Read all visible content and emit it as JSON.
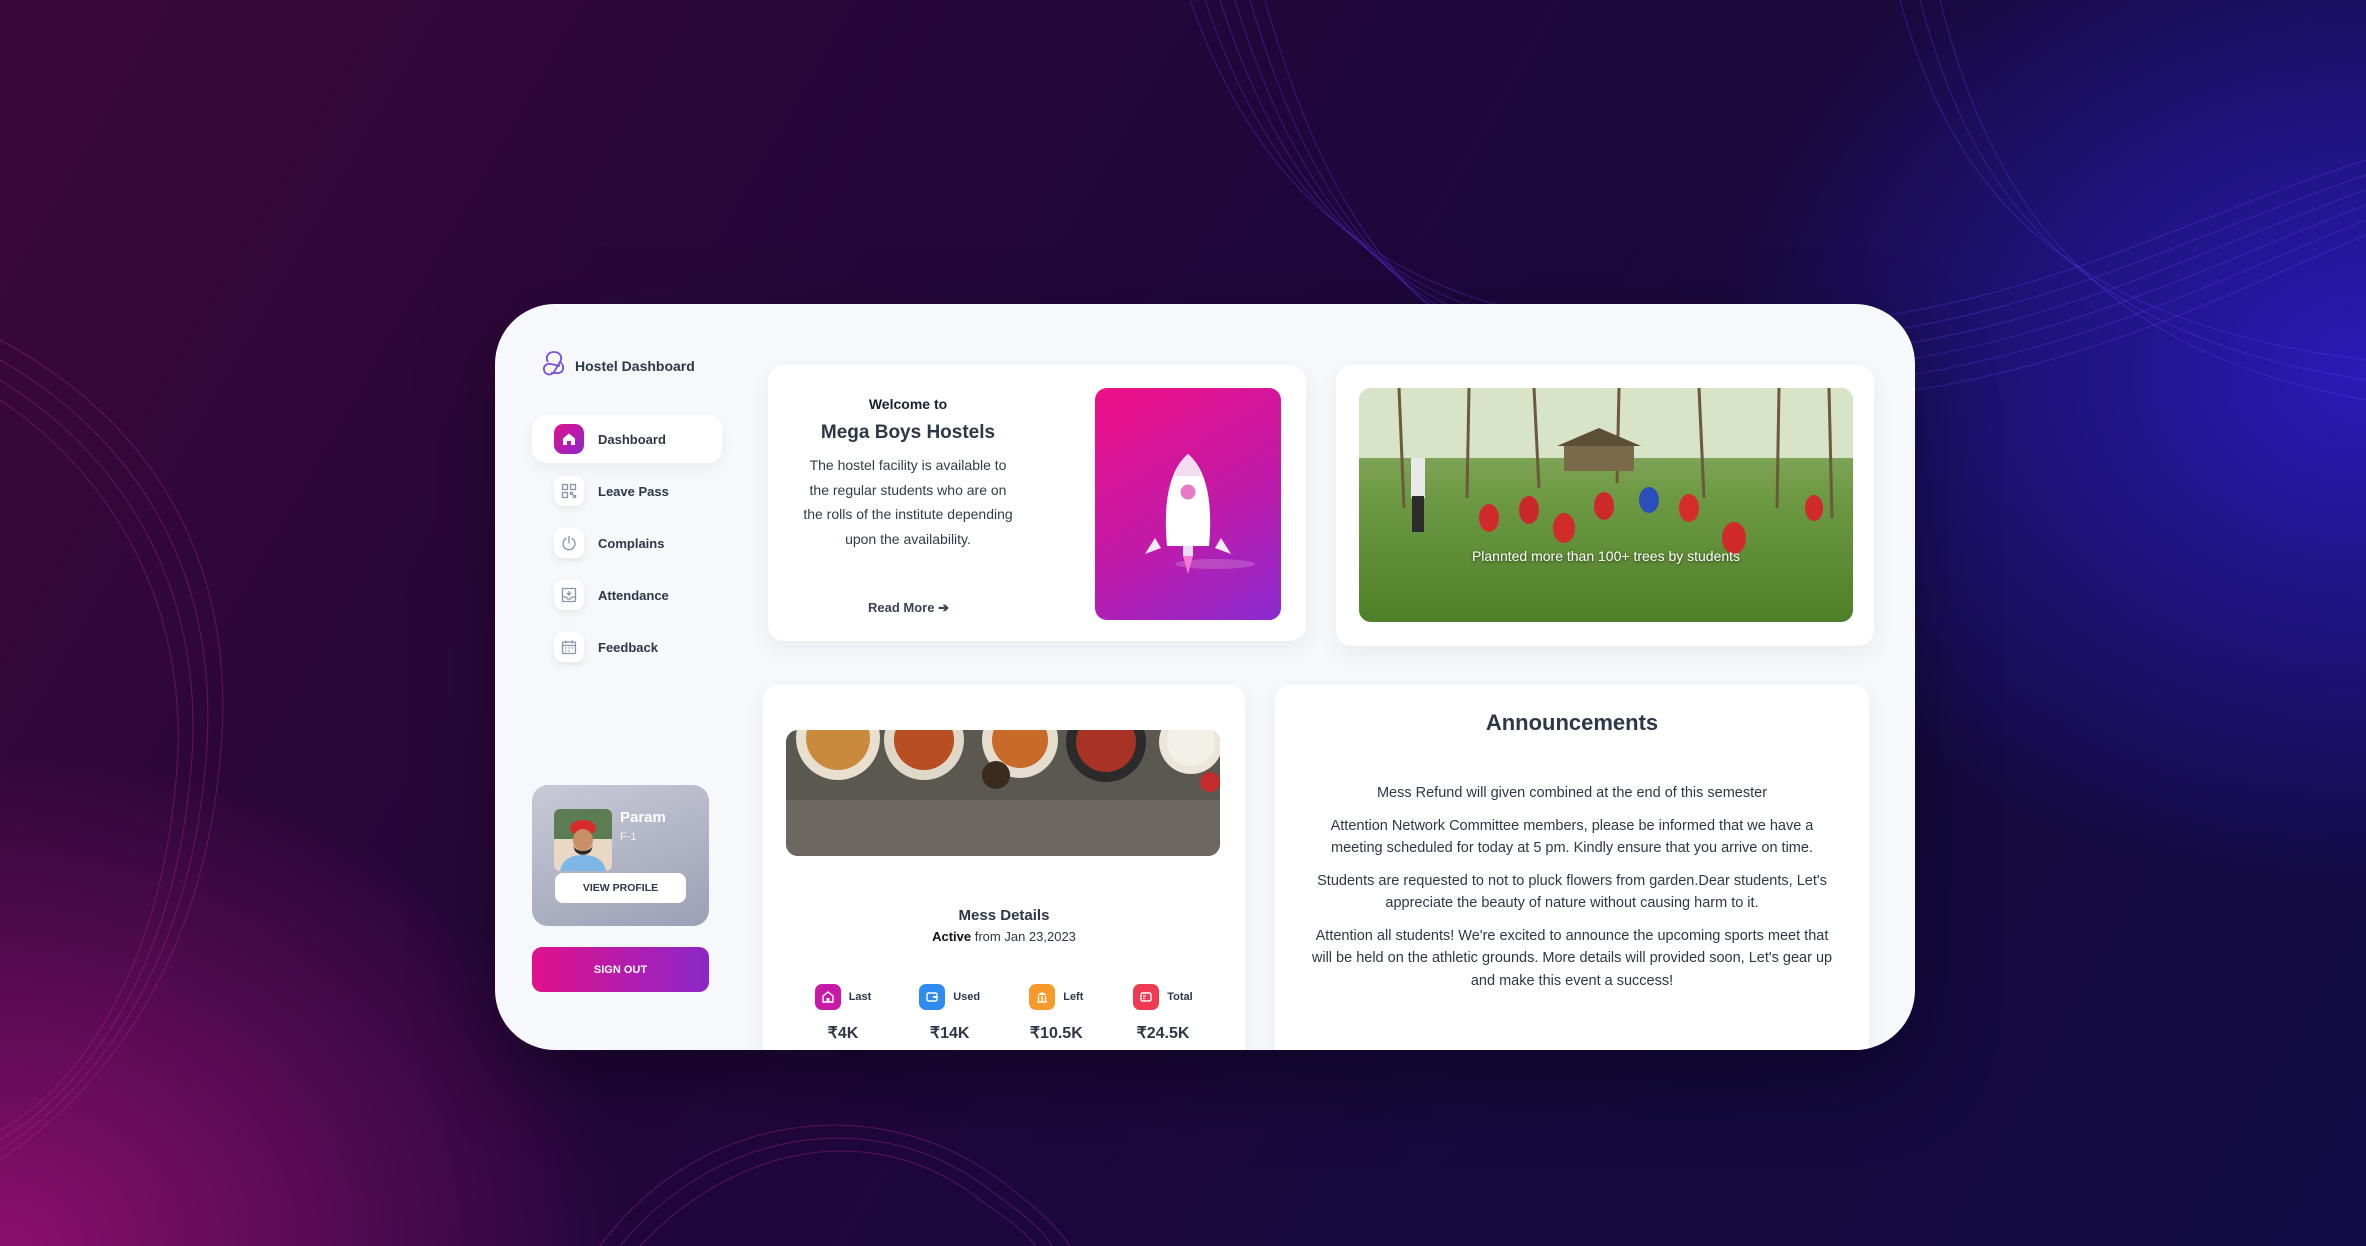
{
  "brand": {
    "name": "Hostel Dashboard"
  },
  "sidebar": {
    "items": [
      {
        "label": "Dashboard",
        "icon": "home-icon",
        "active": true
      },
      {
        "label": "Leave Pass",
        "icon": "qr-icon"
      },
      {
        "label": "Complains",
        "icon": "power-icon"
      },
      {
        "label": "Attendance",
        "icon": "inbox-icon"
      },
      {
        "label": "Feedback",
        "icon": "calendar-icon"
      }
    ]
  },
  "profile": {
    "name": "Param",
    "room": "F-1",
    "view_label": "VIEW PROFILE"
  },
  "signout_label": "SIGN OUT",
  "welcome": {
    "pre": "Welcome to",
    "title": "Mega Boys Hostels",
    "body": "The hostel facility is available to the regular students who are on the rolls of the institute depending upon the availability.",
    "read_more": "Read More"
  },
  "carousel": {
    "caption": "Plannted more than 100+ trees by students"
  },
  "mess": {
    "title": "Mess Details",
    "status": "Active",
    "since": "from Jan 23,2023",
    "stats": [
      {
        "label": "Last",
        "value": "₹4K",
        "color": "#c71aa7",
        "icon": "house-icon"
      },
      {
        "label": "Used",
        "value": "₹14K",
        "color": "#2f8bf0",
        "icon": "wallet-icon"
      },
      {
        "label": "Left",
        "value": "₹10.5K",
        "color": "#f59a2b",
        "icon": "bank-icon"
      },
      {
        "label": "Total",
        "value": "₹24.5K",
        "color": "#ee3a52",
        "icon": "card-icon"
      }
    ]
  },
  "announcements": {
    "title": "Announcements",
    "items": [
      "Mess Refund will given combined at the end of this semester",
      "Attention Network Committee members, please be informed that we have a meeting scheduled for today at 5 pm. Kindly ensure that you arrive on time.",
      "Students are requested to not to pluck flowers from garden.Dear students, Let's appreciate the beauty of nature without causing harm to it.",
      "Attention all students! We're excited to announce the upcoming sports meet that will be held on the athletic grounds. More details will provided soon, Let's gear up and make this event a success!"
    ]
  },
  "colors": {
    "accent_start": "#e0118c",
    "accent_end": "#8b27c9"
  }
}
